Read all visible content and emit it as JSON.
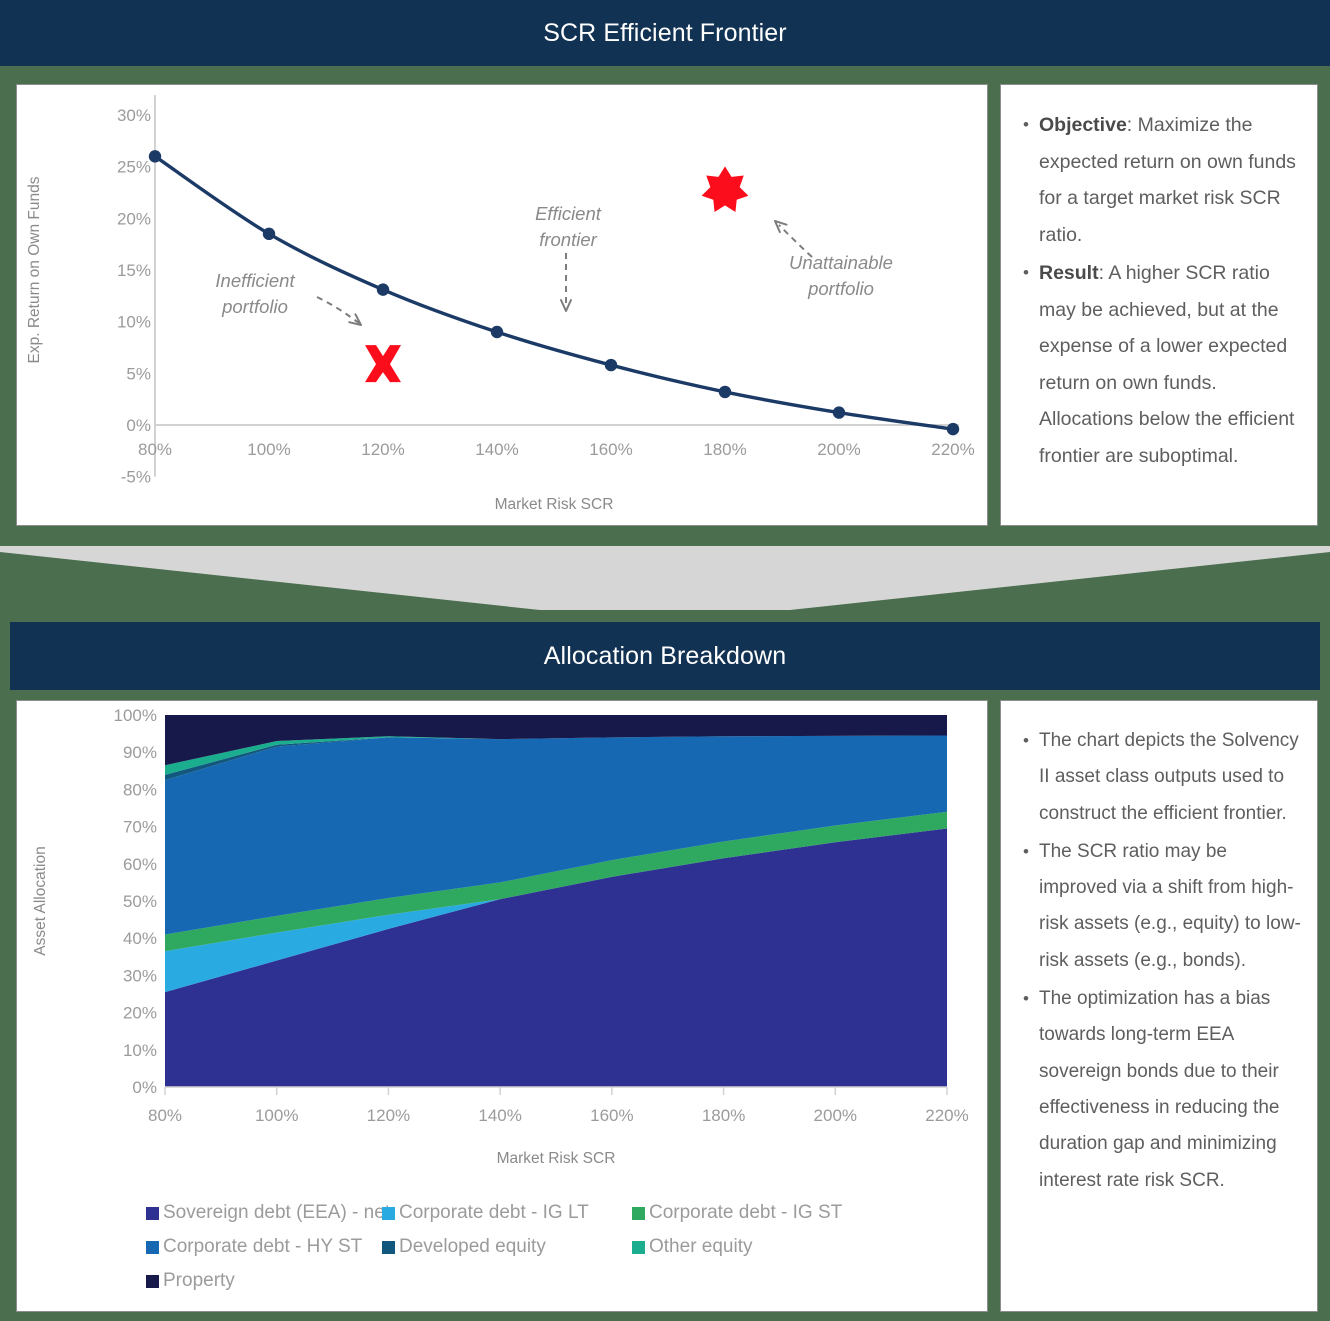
{
  "theme": {
    "background_green": "#4a6e4e",
    "header_navy": "#123253",
    "divider_gray": "#d6d6d6",
    "card_border": "#8c8c8c",
    "text_gray": "#5e5e5e",
    "tick_gray": "#9b9b9b",
    "line_navy": "#1b3a66",
    "marker_red": "#fc0d1b"
  },
  "section1": {
    "header_title": "SCR Efficient Frontier",
    "notes": [
      {
        "bold": "Objective",
        "rest": ": Maximize the expected return on own funds for a target market risk SCR ratio."
      },
      {
        "bold": "Result",
        "rest": ": A higher SCR ratio may be achieved, but at the expense of a lower expected return on own funds. Allocations below the efficient frontier are suboptimal."
      }
    ]
  },
  "section2": {
    "header_title": "Allocation Breakdown",
    "notes": [
      {
        "bold": "",
        "rest": "The chart depicts the Solvency II asset class outputs used to construct the efficient frontier."
      },
      {
        "bold": "",
        "rest": "The SCR ratio may be improved via a shift from high-risk assets (e.g., equity) to low-risk assets (e.g., bonds)."
      },
      {
        "bold": "",
        "rest": "The optimization has a bias towards long-term EEA sovereign bonds due to their effectiveness in reducing the duration gap and minimizing interest rate risk SCR."
      }
    ],
    "legend": [
      {
        "label": "Sovereign debt (EEA) - net",
        "color": "#2e3192"
      },
      {
        "label": "Corporate debt - IG LT",
        "color": "#29abe2"
      },
      {
        "label": "Corporate debt - IG ST",
        "color": "#2fa860"
      },
      {
        "label": "Corporate debt - HY ST",
        "color": "#1668b3"
      },
      {
        "label": "Developed equity",
        "color": "#12577d"
      },
      {
        "label": "Other equity",
        "color": "#1aae8e"
      },
      {
        "label": "Property",
        "color": "#17194a"
      }
    ]
  },
  "chart_data": [
    {
      "type": "line",
      "title": "SCR Efficient Frontier",
      "xlabel": "Market Risk SCR",
      "ylabel": "Exp. Return on Own Funds",
      "x": [
        80,
        100,
        120,
        140,
        160,
        180,
        200,
        220
      ],
      "xtick_labels": [
        "80%",
        "100%",
        "120%",
        "140%",
        "160%",
        "180%",
        "200%",
        "220%"
      ],
      "ytick_labels": [
        "-5%",
        "0%",
        "5%",
        "10%",
        "15%",
        "20%",
        "25%",
        "30%"
      ],
      "ytick_values": [
        -5,
        0,
        5,
        10,
        15,
        20,
        25,
        30
      ],
      "xlim": [
        80,
        220
      ],
      "ylim": [
        -5,
        30
      ],
      "series": [
        {
          "name": "Efficient frontier",
          "values": [
            26.0,
            18.5,
            13.1,
            9.0,
            5.8,
            3.2,
            1.2,
            -0.4
          ],
          "color": "#1b3a66"
        }
      ],
      "markers": [
        {
          "name": "Inefficient portfolio",
          "shape": "cross",
          "x": 120,
          "y": 5.6,
          "color": "#fc0d1b"
        },
        {
          "name": "Unattainable portfolio",
          "shape": "star",
          "x": 180,
          "y": 22.7,
          "color": "#fc0d1b"
        }
      ],
      "annotations": [
        {
          "text": "Inefficient portfolio",
          "target": "cross"
        },
        {
          "text": "Efficient frontier",
          "target": "line"
        },
        {
          "text": "Unattainable portfolio",
          "target": "star"
        }
      ],
      "grid": false,
      "legend": "none"
    },
    {
      "type": "area",
      "title": "Allocation Breakdown",
      "xlabel": "Market Risk SCR",
      "ylabel": "Asset Allocation",
      "x": [
        80,
        100,
        120,
        140,
        160,
        180,
        200,
        220
      ],
      "xtick_labels": [
        "80%",
        "100%",
        "120%",
        "140%",
        "160%",
        "180%",
        "200%",
        "220%"
      ],
      "ytick_labels": [
        "0%",
        "10%",
        "20%",
        "30%",
        "40%",
        "50%",
        "60%",
        "70%",
        "80%",
        "90%",
        "100%"
      ],
      "ytick_values": [
        0,
        10,
        20,
        30,
        40,
        50,
        60,
        70,
        80,
        90,
        100
      ],
      "xlim": [
        80,
        220
      ],
      "ylim": [
        0,
        100
      ],
      "stacked": true,
      "legend": "bottom",
      "series": [
        {
          "name": "Sovereign debt (EEA) - net",
          "color": "#2e3192",
          "values": [
            25.5,
            34.0,
            42.5,
            50.5,
            56.5,
            61.5,
            65.8,
            69.5
          ]
        },
        {
          "name": "Corporate debt - IG LT",
          "color": "#29abe2",
          "values": [
            11.0,
            7.5,
            3.8,
            0.0,
            0.0,
            0.0,
            0.0,
            0.0
          ]
        },
        {
          "name": "Corporate debt - IG ST",
          "color": "#2fa860",
          "values": [
            4.5,
            4.5,
            4.5,
            4.5,
            4.5,
            4.5,
            4.5,
            4.5
          ]
        },
        {
          "name": "Corporate debt - HY ST",
          "color": "#1668b3",
          "values": [
            41.5,
            45.5,
            43.2,
            38.5,
            33.0,
            28.3,
            24.1,
            20.5
          ]
        },
        {
          "name": "Developed equity",
          "color": "#12577d",
          "values": [
            1.4,
            0.5,
            0.0,
            0.0,
            0.0,
            0.0,
            0.0,
            0.0
          ]
        },
        {
          "name": "Other equity",
          "color": "#1aae8e",
          "values": [
            2.6,
            1.0,
            0.3,
            0.0,
            0.0,
            0.0,
            0.0,
            0.0
          ]
        },
        {
          "name": "Property",
          "color": "#17194a",
          "values": [
            13.5,
            7.0,
            5.7,
            6.5,
            6.0,
            5.7,
            5.6,
            5.5
          ]
        }
      ]
    }
  ]
}
